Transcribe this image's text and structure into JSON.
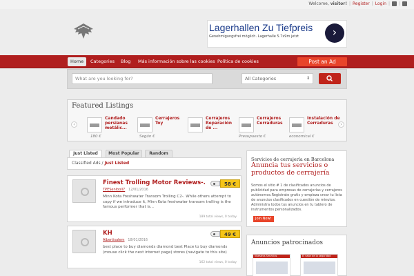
{
  "topbar": {
    "welcome_prefix": "Welcome,",
    "user": "visitor!",
    "register": "Register",
    "login": "Login",
    "sep": "|",
    "icons": [
      "rss-icon",
      "twitter-icon"
    ]
  },
  "header_ad": {
    "title": "Lagerhallen Zu Tiefpreis",
    "subtitle": "Genehmigungsfrei möglich. Lagerhalle 5.7x9m jetzt",
    "arrow": "›"
  },
  "nav": {
    "items": [
      "Home",
      "Categories",
      "Blog",
      "Más información sobre las cookies",
      "Política de cookies"
    ],
    "post_ad": "Post an Ad"
  },
  "search": {
    "placeholder": "What are you looking for?",
    "category": "All Categories",
    "category_arrow": "⇕"
  },
  "featured": {
    "title": "Featured Listings",
    "prev": "‹",
    "next": "›",
    "items": [
      {
        "title": "Candado persianas metálic...",
        "price": "180 €"
      },
      {
        "title": "Cerrajeros Toy",
        "price": "Según €"
      },
      {
        "title": "Cerrajeros Reparación de ...",
        "price": ""
      },
      {
        "title": "Cerrajeros Cerraduras",
        "price": "Presupuesto €"
      },
      {
        "title": "Instalación de Cerraduras",
        "price": "economical €"
      }
    ]
  },
  "tabs": [
    "Just Listed",
    "Most Popular",
    "Random"
  ],
  "breadcrumb": {
    "root": "Classified Ads",
    "sep": "/",
    "current": "Just Listed"
  },
  "listings": [
    {
      "title": "Finest Trolling Motor Reviews-.",
      "author": "TPESeniboll7",
      "date": "12/01/2016",
      "price": "58 €",
      "desc": "Minn Kota Freshwater Transom Trolling C2-. While others attempt to copy if we introduce it, Minn Kota freshwater transom trolling is the famous performer that is...",
      "stats": "189 total views, 0 today"
    },
    {
      "title": "KH",
      "author": "Albertisalem",
      "date": "18/01/2016",
      "price": "49 €",
      "desc": "best place to buy diamonds diamond best Place to buy diamonds (mouse click the next internet page) stores (navigate to this site)",
      "stats": "162 total views, 0 today"
    }
  ],
  "sidebar": {
    "head": "Servicios de cerrajería en Barcelona",
    "title": "Anuncia tus servicios o productos de cerrajería",
    "body": "Somos el sitio # 1 de clasificados anuncios de publicidad para empresas de cerrajerías y cerrajeros autónomos.Registrate gratis y empieza crear tu lista de anuncios clasificados en cuestión de minutos. Administra todos tus anuncios en tu tablero de instrumentos personalizados.",
    "button": "Join Now!"
  },
  "sponsored": {
    "title": "Anuncios patrocinados",
    "ads": [
      "Nuestros Servicios",
      "El valor de la seguridad"
    ]
  }
}
